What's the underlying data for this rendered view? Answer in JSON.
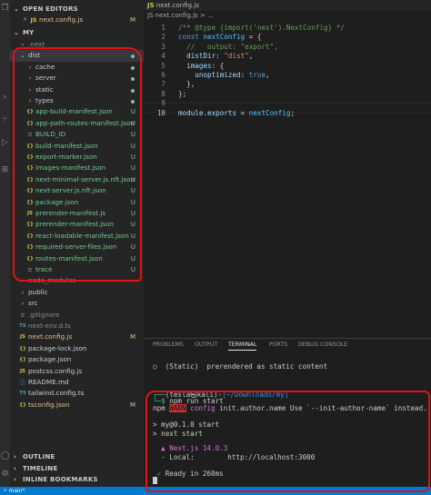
{
  "sidebar": {
    "open_editors_title": "OPEN EDITORS",
    "open_editor_file": "next.config.js",
    "open_editor_badge": "M",
    "project_title": "MY",
    "items": [
      {
        "label": ".next",
        "kind": "folder",
        "badge": ""
      },
      {
        "label": "dist",
        "kind": "folder-open",
        "badge": ""
      },
      {
        "label": "cache",
        "kind": "folder",
        "badge": ""
      },
      {
        "label": "server",
        "kind": "folder",
        "badge": ""
      },
      {
        "label": "static",
        "kind": "folder",
        "badge": ""
      },
      {
        "label": "types",
        "kind": "folder",
        "badge": ""
      },
      {
        "label": "app-build-manifest.json",
        "kind": "json",
        "badge": "U"
      },
      {
        "label": "app-path-routes-manifest.json",
        "kind": "json",
        "badge": "U"
      },
      {
        "label": "BUILD_ID",
        "kind": "file",
        "badge": "U"
      },
      {
        "label": "build-manifest.json",
        "kind": "json",
        "badge": "U"
      },
      {
        "label": "export-marker.json",
        "kind": "json",
        "badge": "U"
      },
      {
        "label": "images-manifest.json",
        "kind": "json",
        "badge": "U"
      },
      {
        "label": "next-minimal-server.js.nft.json",
        "kind": "json",
        "badge": "U"
      },
      {
        "label": "next-server.js.nft.json",
        "kind": "json",
        "badge": "U"
      },
      {
        "label": "package.json",
        "kind": "json",
        "badge": "U"
      },
      {
        "label": "prerender-manifest.js",
        "kind": "js",
        "badge": "U"
      },
      {
        "label": "prerender-manifest.json",
        "kind": "json",
        "badge": "U"
      },
      {
        "label": "react-loadable-manifest.json",
        "kind": "json",
        "badge": "U"
      },
      {
        "label": "required-server-files.json",
        "kind": "json",
        "badge": "U"
      },
      {
        "label": "routes-manifest.json",
        "kind": "json",
        "badge": "U"
      },
      {
        "label": "trace",
        "kind": "file",
        "badge": "U"
      },
      {
        "label": "node_modules",
        "kind": "folder",
        "badge": ""
      },
      {
        "label": "public",
        "kind": "folder",
        "badge": ""
      },
      {
        "label": "src",
        "kind": "folder",
        "badge": ""
      },
      {
        "label": ".gitignore",
        "kind": "file",
        "badge": ""
      },
      {
        "label": "next-env.d.ts",
        "kind": "ts",
        "badge": ""
      },
      {
        "label": "next.config.js",
        "kind": "js",
        "badge": "M"
      },
      {
        "label": "package-lock.json",
        "kind": "json",
        "badge": ""
      },
      {
        "label": "package.json",
        "kind": "json",
        "badge": ""
      },
      {
        "label": "postcss.config.js",
        "kind": "js",
        "badge": ""
      },
      {
        "label": "README.md",
        "kind": "md",
        "badge": ""
      },
      {
        "label": "tailwind.config.ts",
        "kind": "ts",
        "badge": ""
      },
      {
        "label": "tsconfig.json",
        "kind": "json",
        "badge": "M"
      }
    ],
    "outline_title": "OUTLINE",
    "timeline_title": "TIMELINE",
    "bookmarks_title": "INLINE BOOKMARKS"
  },
  "editor": {
    "tab_label": "next.config.js",
    "breadcrumb": "JS next.config.js > ...",
    "line_numbers": [
      "1",
      "2",
      "3",
      "4",
      "5",
      "6",
      "7",
      "8",
      "9",
      "10"
    ],
    "lines": [
      "/** @type {import('next').NextConfig} */",
      "const nextConfig = {",
      "  //   output: \"export\",",
      "  distDir: \"dist\",",
      "  images: {",
      "    unoptimized: true,",
      "  },",
      "};",
      "",
      "module.exports = nextConfig;"
    ]
  },
  "panel": {
    "tabs": [
      "PROBLEMS",
      "OUTPUT",
      "TERMINAL",
      "PORTS",
      "DEBUG CONSOLE"
    ],
    "active_tab": "TERMINAL",
    "lines": [
      "○  (Static)  prerendered as static content",
      "",
      "┌──(tesla㉿kali)-[~/Downloads/my]",
      "└─$ npm run start",
      "npm WARN config init.author.name Use `--init-author-name` instead.",
      "",
      "> my@0.1.0 start",
      "> next start",
      "",
      "  ▲ Next.js 14.0.3",
      "  - Local:        http://localhost:3000",
      "",
      " ✓ Ready in 260ms"
    ]
  },
  "statusbar": {
    "branch": "main*"
  },
  "colors": {
    "annotation": "#e41016",
    "untracked": "#73c991",
    "modified": "#e2c08d"
  }
}
